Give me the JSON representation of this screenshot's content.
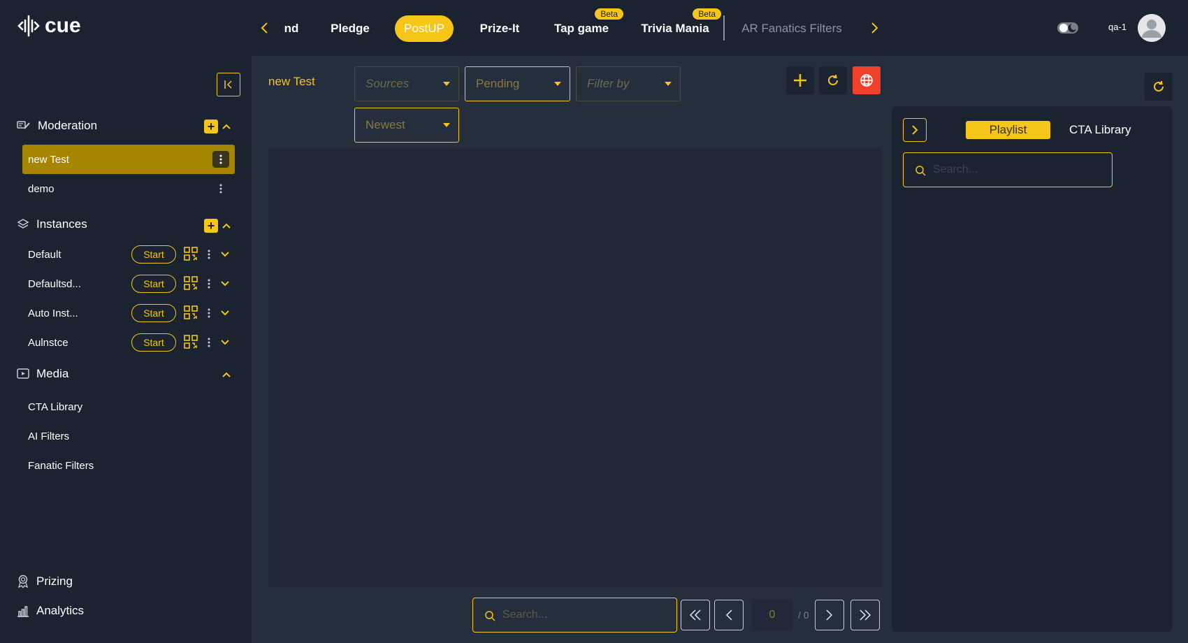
{
  "brand": {
    "name": "cue"
  },
  "nav": {
    "tabs": [
      {
        "label": "nd",
        "active": false
      },
      {
        "label": "Pledge",
        "active": false
      },
      {
        "label": "PostUP",
        "active": true
      },
      {
        "label": "Prize-It",
        "active": false
      },
      {
        "label": "Tap game",
        "badge": "Beta"
      },
      {
        "label": "Trivia Mania",
        "badge": "Beta"
      },
      {
        "label": "AR Fanatics Filters",
        "faded": true
      }
    ]
  },
  "user": {
    "name": "qa-1"
  },
  "sidebar": {
    "moderation": {
      "title": "Moderation",
      "items": [
        {
          "label": "new Test",
          "active": true
        },
        {
          "label": "demo",
          "active": false
        }
      ]
    },
    "instances": {
      "title": "Instances",
      "start_label": "Start",
      "items": [
        {
          "label": "Default"
        },
        {
          "label": "Defaultsd..."
        },
        {
          "label": "Auto Inst..."
        },
        {
          "label": "Aulnstce"
        }
      ]
    },
    "media": {
      "title": "Media",
      "items": [
        {
          "label": "CTA Library"
        },
        {
          "label": "AI Filters"
        },
        {
          "label": "Fanatic Filters"
        }
      ]
    },
    "bottom": [
      {
        "label": "Prizing",
        "icon": "award-icon"
      },
      {
        "label": "Analytics",
        "icon": "bar-chart-icon"
      }
    ]
  },
  "main": {
    "title": "new Test",
    "filters": {
      "sources": "Sources",
      "status": "Pending",
      "filter_by": "Filter by",
      "sort": "Newest"
    },
    "search_placeholder": "Search...",
    "pagination": {
      "current": "0",
      "total": "/ 0"
    }
  },
  "right_panel": {
    "tabs": [
      {
        "label": "Playlist",
        "active": true
      },
      {
        "label": "CTA Library",
        "active": false
      }
    ],
    "search_placeholder": "Search..."
  },
  "colors": {
    "accent": "#f5c518",
    "active_item": "#a68600",
    "danger": "#f0412d",
    "background": "#1b2230",
    "panel": "#252e3d"
  }
}
